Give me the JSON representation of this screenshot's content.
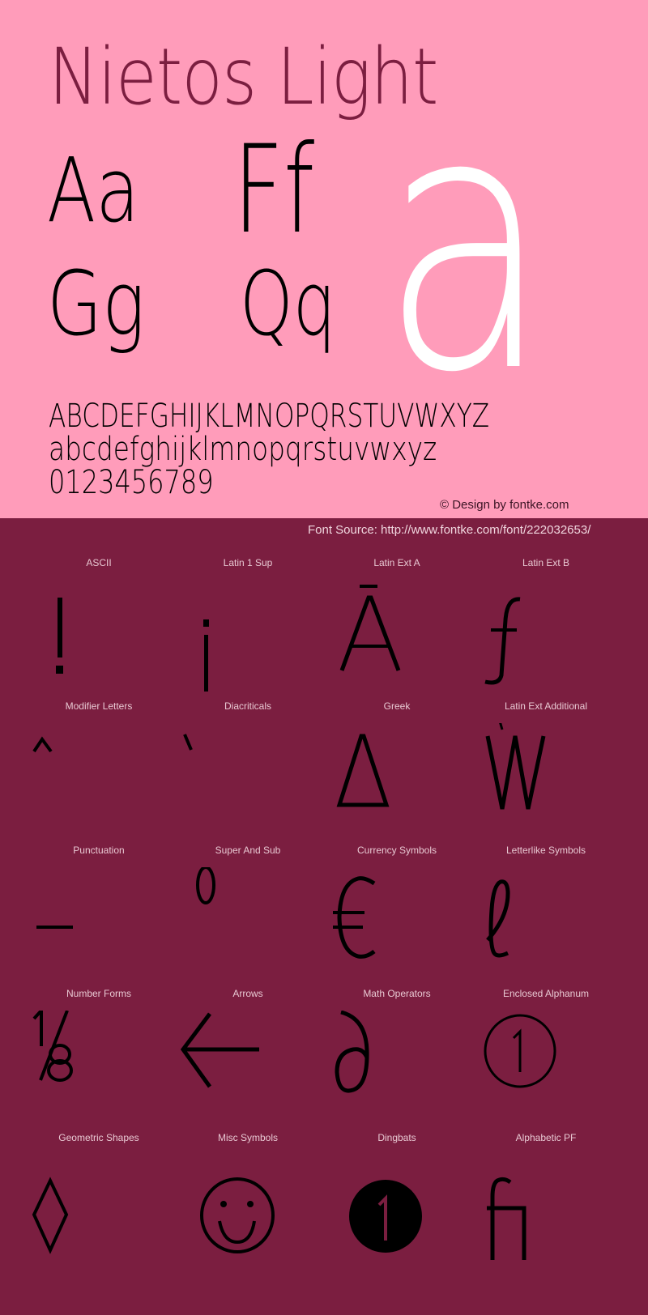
{
  "header": {
    "title": "Nietos Light",
    "samples": {
      "pair1": "Aa",
      "pair2": "Ff",
      "pair3": "Gg",
      "pair4": "Qq",
      "big_letter": "a"
    },
    "alphabet_upper": "ABCDEFGHIJKLMNOPQRSTUVWXYZ",
    "alphabet_lower": "abcdefghijklmnopqrstuvwxyz",
    "digits": "0123456789",
    "credit": "© Design by fontke.com",
    "source": "Font Source: http://www.fontke.com/font/222032653/"
  },
  "colors": {
    "top_background": "#ff9cba",
    "bottom_background": "#7b1e40",
    "title_color": "#7b1e40",
    "glyph_color": "#000000",
    "big_letter_color": "#ffffff"
  },
  "blocks": [
    {
      "label": "ASCII",
      "glyph": "!",
      "icon": "exclamation-glyph"
    },
    {
      "label": "Latin 1 Sup",
      "glyph": "¡",
      "icon": "inverted-exclamation-glyph"
    },
    {
      "label": "Latin Ext A",
      "glyph": "Ā",
      "icon": "a-macron-glyph"
    },
    {
      "label": "Latin Ext B",
      "glyph": "ƒ",
      "icon": "f-hook-glyph"
    },
    {
      "label": "Modifier Letters",
      "glyph": "ˆ",
      "icon": "circumflex-glyph"
    },
    {
      "label": "Diacriticals",
      "glyph": "̀",
      "icon": "grave-accent-glyph"
    },
    {
      "label": "Greek",
      "glyph": "Δ",
      "icon": "delta-glyph"
    },
    {
      "label": "Latin Ext Additional",
      "glyph": "Ẁ",
      "icon": "w-grave-glyph"
    },
    {
      "label": "Punctuation",
      "glyph": "–",
      "icon": "en-dash-glyph"
    },
    {
      "label": "Super And Sub",
      "glyph": "⁰",
      "icon": "superscript-zero-glyph"
    },
    {
      "label": "Currency Symbols",
      "glyph": "€",
      "icon": "euro-glyph"
    },
    {
      "label": "Letterlike Symbols",
      "glyph": "ℓ",
      "icon": "script-l-glyph"
    },
    {
      "label": "Number Forms",
      "glyph": "⅛",
      "icon": "one-eighth-glyph"
    },
    {
      "label": "Arrows",
      "glyph": "←",
      "icon": "left-arrow-glyph"
    },
    {
      "label": "Math Operators",
      "glyph": "∂",
      "icon": "partial-differential-glyph"
    },
    {
      "label": "Enclosed Alphanum",
      "glyph": "①",
      "icon": "circled-one-glyph"
    },
    {
      "label": "Geometric Shapes",
      "glyph": "◊",
      "icon": "lozenge-glyph"
    },
    {
      "label": "Misc Symbols",
      "glyph": "☺",
      "icon": "smiley-glyph"
    },
    {
      "label": "Dingbats",
      "glyph": "❶",
      "icon": "negative-circled-one-glyph"
    },
    {
      "label": "Alphabetic PF",
      "glyph": "ﬁ",
      "icon": "fi-ligature-glyph"
    }
  ]
}
